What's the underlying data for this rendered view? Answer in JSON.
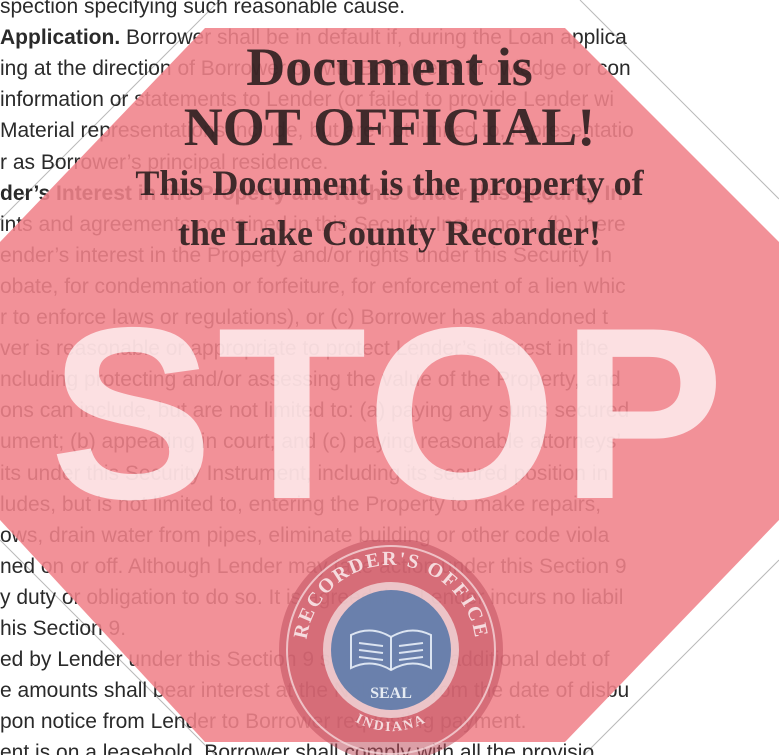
{
  "document": {
    "lines": [
      {
        "text": "spection specifying such reasonable cause."
      },
      {
        "heading": "Application.",
        "text": " Borrower shall be in default if, during the Loan applica"
      },
      {
        "text": "ing at the direction of Borrower or with Borrower’s knowledge or con"
      },
      {
        "text": "information or statements to Lender (or failed to provide Lender wi"
      },
      {
        "text": "Material representations include, but are not limited to, representatio"
      },
      {
        "text": "r as Borrower’s principal residence."
      },
      {
        "heading": "der’s Interest in the Property and Rights Under this Security In",
        "text": ""
      },
      {
        "text": "ints and agreements contained in this Security Instrument, (b) there"
      },
      {
        "text": "ender’s interest in the Property and/or rights under this Security In"
      },
      {
        "text": "obate, for condemnation or forfeiture, for enforcement of a lien whic"
      },
      {
        "text": "r to enforce laws or regulations), or (c) Borrower has abandoned t"
      },
      {
        "text": "ver is reasonable or appropriate to protect Lender’s interest in the"
      },
      {
        "text": "ncluding protecting and/or assessing the value of the Property, and"
      },
      {
        "text": "ons can include, but are not limited to: (a) paying any sums secured"
      },
      {
        "text": "ument; (b) appearing in court; and (c) paying reasonable attorneys’"
      },
      {
        "text": "its under this Security Instrument, including its secured position in"
      },
      {
        "text": "ludes, but is not limited to, entering the Property to make repairs,"
      },
      {
        "text": "ows, drain water from pipes, eliminate building or other code viola"
      },
      {
        "text": "ned on or off. Although Lender may take action under this Section 9"
      },
      {
        "text": "y duty or obligation to do so. It is agreed that Lender incurs no liabil"
      },
      {
        "text": "his Section 9."
      },
      {
        "text": "ed by Lender under this Section 9 shall become additional debt of"
      },
      {
        "text": "e amounts shall bear interest at the Note rate from the date of disbu"
      },
      {
        "text": "pon notice from Lender to Borrower requesting payment."
      },
      {
        "text": "ent is on a leasehold, Borrower shall comply with all the provisio"
      }
    ]
  },
  "watermark": {
    "line1": "Document is",
    "line2": "NOT OFFICIAL!",
    "line3": "This Document is the property of",
    "line4": "the Lake County Recorder!",
    "sign_word": "STOP",
    "sign_color": "#f0828a",
    "seal_text_top": "RECORDER'S OFFICE",
    "seal_text_bottom": "SEAL",
    "seal_state": "INDIANA",
    "seal_ring_color": "#c0505e",
    "seal_center_color": "#4a6fa5"
  }
}
